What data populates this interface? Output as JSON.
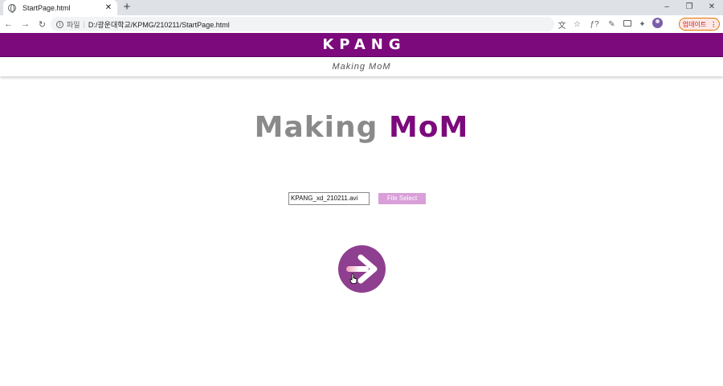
{
  "browser": {
    "tab_title": "StartPage.html",
    "tab_close": "✕",
    "new_tab": "+",
    "window_controls": {
      "minimize": "–",
      "restore": "❐",
      "close": "✕"
    },
    "nav": {
      "back": "←",
      "forward": "→",
      "reload": "↻"
    },
    "url_scheme_label": "파일",
    "url_separator": "|",
    "url_path": "D:/광운대학교/KPMG/210211/StartPage.html",
    "toolbar_icons": [
      "translate-icon",
      "star-icon",
      "function-icon",
      "pen-extension-icon",
      "extension-box-icon",
      "puzzle-icon",
      "profile-avatar"
    ],
    "icon_glyphs": {
      "translate": "文",
      "star": "☆",
      "function": "ƒ?",
      "pen": "✎",
      "puzzle": "✦"
    },
    "update_label": "업데이트",
    "update_menu": "⋮",
    "update_color": "#c5221f"
  },
  "page": {
    "brand_title": "KPANG",
    "brand_color": "#7c0a7c",
    "subtitle": "Making MoM",
    "hero": {
      "word1": "Making",
      "word2": "MoM",
      "word1_color": "#8a8a8a",
      "word2_color": "#7c0a7c"
    },
    "file_input_value": "KPANG_xd_210211.avi",
    "file_select_label": "File Select",
    "file_select_color": "#d99fd9",
    "go_button_icon": "arrow-right-icon",
    "go_button_color": "#8f3f8f"
  }
}
